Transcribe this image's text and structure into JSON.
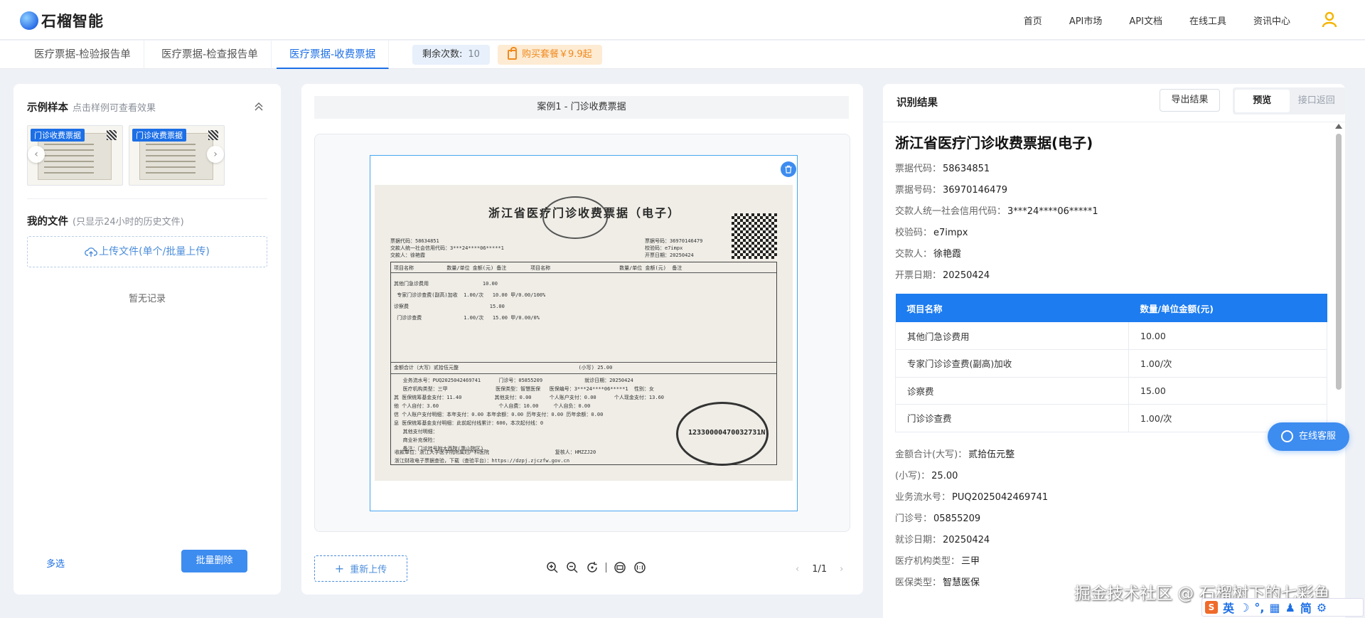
{
  "header": {
    "logo_text": "石榴智能",
    "nav": [
      "首页",
      "API市场",
      "API文档",
      "在线工具",
      "资讯中心"
    ]
  },
  "tabs": [
    {
      "label": "医疗票据-检验报告单",
      "active": false
    },
    {
      "label": "医疗票据-检查报告单",
      "active": false
    },
    {
      "label": "医疗票据-收费票据",
      "active": true
    }
  ],
  "remain": {
    "label": "剩余次数:",
    "value": "10"
  },
  "buy_label": "购买套餐￥9.9起",
  "samples": {
    "title": "示例样本",
    "hint": "点击样例可查看效果",
    "items": [
      {
        "tag": "门诊收费票据"
      },
      {
        "tag": "门诊收费票据"
      }
    ]
  },
  "files": {
    "title": "我的文件",
    "hint": "(只显示24小时的历史文件)",
    "upload_label": "上传文件(单个/批量上传)",
    "empty_text": "暂无记录",
    "multi_select": "多选",
    "batch_delete": "批量删除"
  },
  "viewer": {
    "case_label": "案例1 - 门诊收费票据",
    "reupload": "重新上传",
    "page": "1/1",
    "receipt": {
      "title": "浙江省医疗门诊收费票据（电子）",
      "stamp_id": "12330000470032731N"
    }
  },
  "result": {
    "title": "识别结果",
    "export": "导出结果",
    "seg_preview": "预览",
    "seg_api": "接口返回",
    "doc_title": "浙江省医疗门诊收费票据(电子)",
    "fields_top": [
      {
        "k": "票据代码：",
        "v": "58634851"
      },
      {
        "k": "票据号码：",
        "v": "36970146479"
      },
      {
        "k": "交款人统一社会信用代码：",
        "v": "3***24****06*****1"
      },
      {
        "k": "校验码：",
        "v": "e7impx"
      },
      {
        "k": "交款人：",
        "v": "徐艳霞"
      },
      {
        "k": "开票日期：",
        "v": "20250424"
      }
    ],
    "table_headers": [
      "项目名称",
      "数量/单位金额(元)"
    ],
    "table_rows": [
      [
        "其他门急诊费用",
        "10.00"
      ],
      [
        "专家门诊诊查费(副高)加收",
        "1.00/次"
      ],
      [
        "诊察费",
        "15.00"
      ],
      [
        "门诊诊查费",
        "1.00/次"
      ]
    ],
    "fields_bottom": [
      {
        "k": "金额合计(大写)：",
        "v": "贰拾伍元整"
      },
      {
        "k": "(小写)：",
        "v": "25.00"
      },
      {
        "k": "业务流水号：",
        "v": "PUQ2025042469741"
      },
      {
        "k": "门诊号：",
        "v": "05855209"
      },
      {
        "k": "就诊日期：",
        "v": "20250424"
      },
      {
        "k": "医疗机构类型：",
        "v": "三甲"
      },
      {
        "k": "医保类型：",
        "v": "智慧医保"
      }
    ]
  },
  "service_label": "在线客服",
  "watermark": "掘金技术社区 @ 石榴树下的七彩鱼",
  "ime": {
    "lang": "英",
    "simp": "简"
  },
  "colors": {
    "accent": "#1c6fe6",
    "table_header": "#1c7cf0",
    "buy_text": "#f08a1d"
  }
}
